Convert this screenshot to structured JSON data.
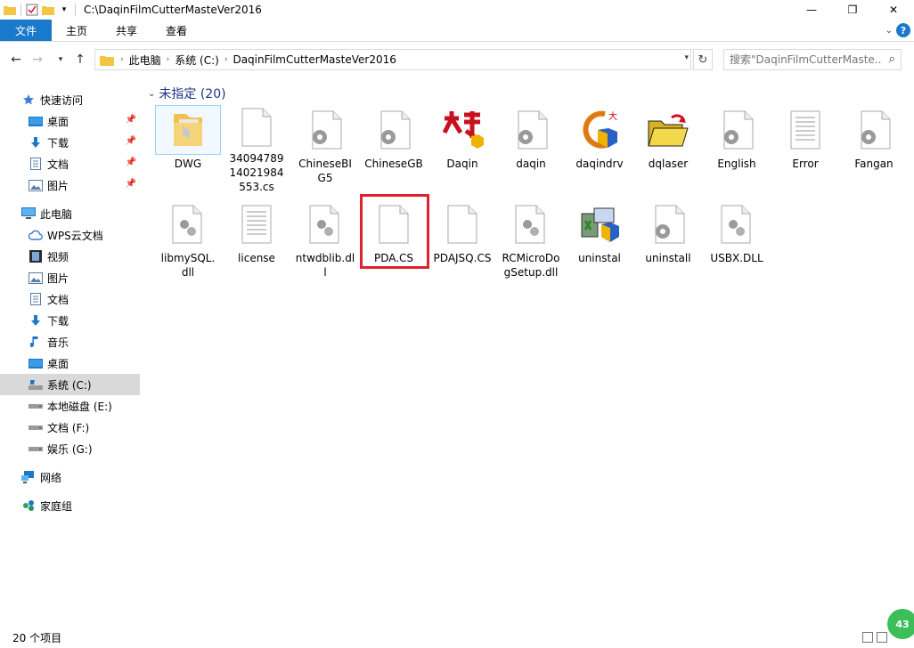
{
  "window": {
    "title": "C:\\DaqinFilmCutterMasteVer2016",
    "minimize": "—",
    "maximize": "❐",
    "close": "✕"
  },
  "ribbon": {
    "tabs": [
      "文件",
      "主页",
      "共享",
      "查看"
    ],
    "help": "?"
  },
  "address": {
    "segments": [
      "此电脑",
      "系统 (C:)",
      "DaqinFilmCutterMasteVer2016"
    ],
    "search_placeholder": "搜索\"DaqinFilmCutterMaste...\""
  },
  "sidebar": {
    "items": [
      {
        "label": "快速访问",
        "icon": "star-icon",
        "pinned": false
      },
      {
        "label": "桌面",
        "icon": "desktop-icon",
        "pinned": true
      },
      {
        "label": "下载",
        "icon": "download-icon",
        "pinned": true
      },
      {
        "label": "文档",
        "icon": "document-icon",
        "pinned": true
      },
      {
        "label": "图片",
        "icon": "pictures-icon",
        "pinned": true
      },
      {
        "label": "此电脑",
        "icon": "computer-icon",
        "pinned": false
      },
      {
        "label": "WPS云文档",
        "icon": "cloud-icon",
        "pinned": false
      },
      {
        "label": "视频",
        "icon": "video-icon",
        "pinned": false
      },
      {
        "label": "图片",
        "icon": "pictures-icon",
        "pinned": false
      },
      {
        "label": "文档",
        "icon": "document-icon",
        "pinned": false
      },
      {
        "label": "下载",
        "icon": "download-icon",
        "pinned": false
      },
      {
        "label": "音乐",
        "icon": "music-icon",
        "pinned": false
      },
      {
        "label": "桌面",
        "icon": "desktop-icon",
        "pinned": false
      },
      {
        "label": "系统 (C:)",
        "icon": "drive-c-icon",
        "pinned": false,
        "selected": true
      },
      {
        "label": "本地磁盘 (E:)",
        "icon": "drive-icon",
        "pinned": false
      },
      {
        "label": "文档 (F:)",
        "icon": "drive-icon",
        "pinned": false
      },
      {
        "label": "娱乐 (G:)",
        "icon": "drive-icon",
        "pinned": false
      },
      {
        "label": "网络",
        "icon": "network-icon",
        "pinned": false
      },
      {
        "label": "家庭组",
        "icon": "homegroup-icon",
        "pinned": false
      }
    ]
  },
  "group": {
    "title": "未指定 (20)"
  },
  "files": [
    {
      "name": "DWG",
      "icon": "folder-icon"
    },
    {
      "name": "34094789 14021984 553.cs",
      "icon": "blank-file-icon"
    },
    {
      "name": "ChineseBIG5",
      "icon": "settings-file-icon"
    },
    {
      "name": "ChineseGB",
      "icon": "settings-file-icon"
    },
    {
      "name": "Daqin",
      "icon": "daqin-app-icon"
    },
    {
      "name": "daqin",
      "icon": "settings-file-icon"
    },
    {
      "name": "daqindrv",
      "icon": "driver-setup-icon"
    },
    {
      "name": "dqlaser",
      "icon": "folder-arrow-icon"
    },
    {
      "name": "English",
      "icon": "settings-file-icon"
    },
    {
      "name": "Error",
      "icon": "text-file-icon"
    },
    {
      "name": "Fangan",
      "icon": "settings-file-icon"
    },
    {
      "name": "libmySQL.dll",
      "icon": "dll-file-icon"
    },
    {
      "name": "license",
      "icon": "text-file-icon"
    },
    {
      "name": "ntwdblib.dll",
      "icon": "dll-file-icon"
    },
    {
      "name": "PDA.CS",
      "icon": "blank-file-icon"
    },
    {
      "name": "PDAJSQ.CS",
      "icon": "blank-file-icon"
    },
    {
      "name": "RCMicroDogSetup.dll",
      "icon": "dll-file-icon"
    },
    {
      "name": "uninstal",
      "icon": "uninstaller-icon"
    },
    {
      "name": "uninstall",
      "icon": "settings-file-icon"
    },
    {
      "name": "USBX.DLL",
      "icon": "dll-file-icon"
    }
  ],
  "status": {
    "count": "20 个项目",
    "badge": "43"
  }
}
